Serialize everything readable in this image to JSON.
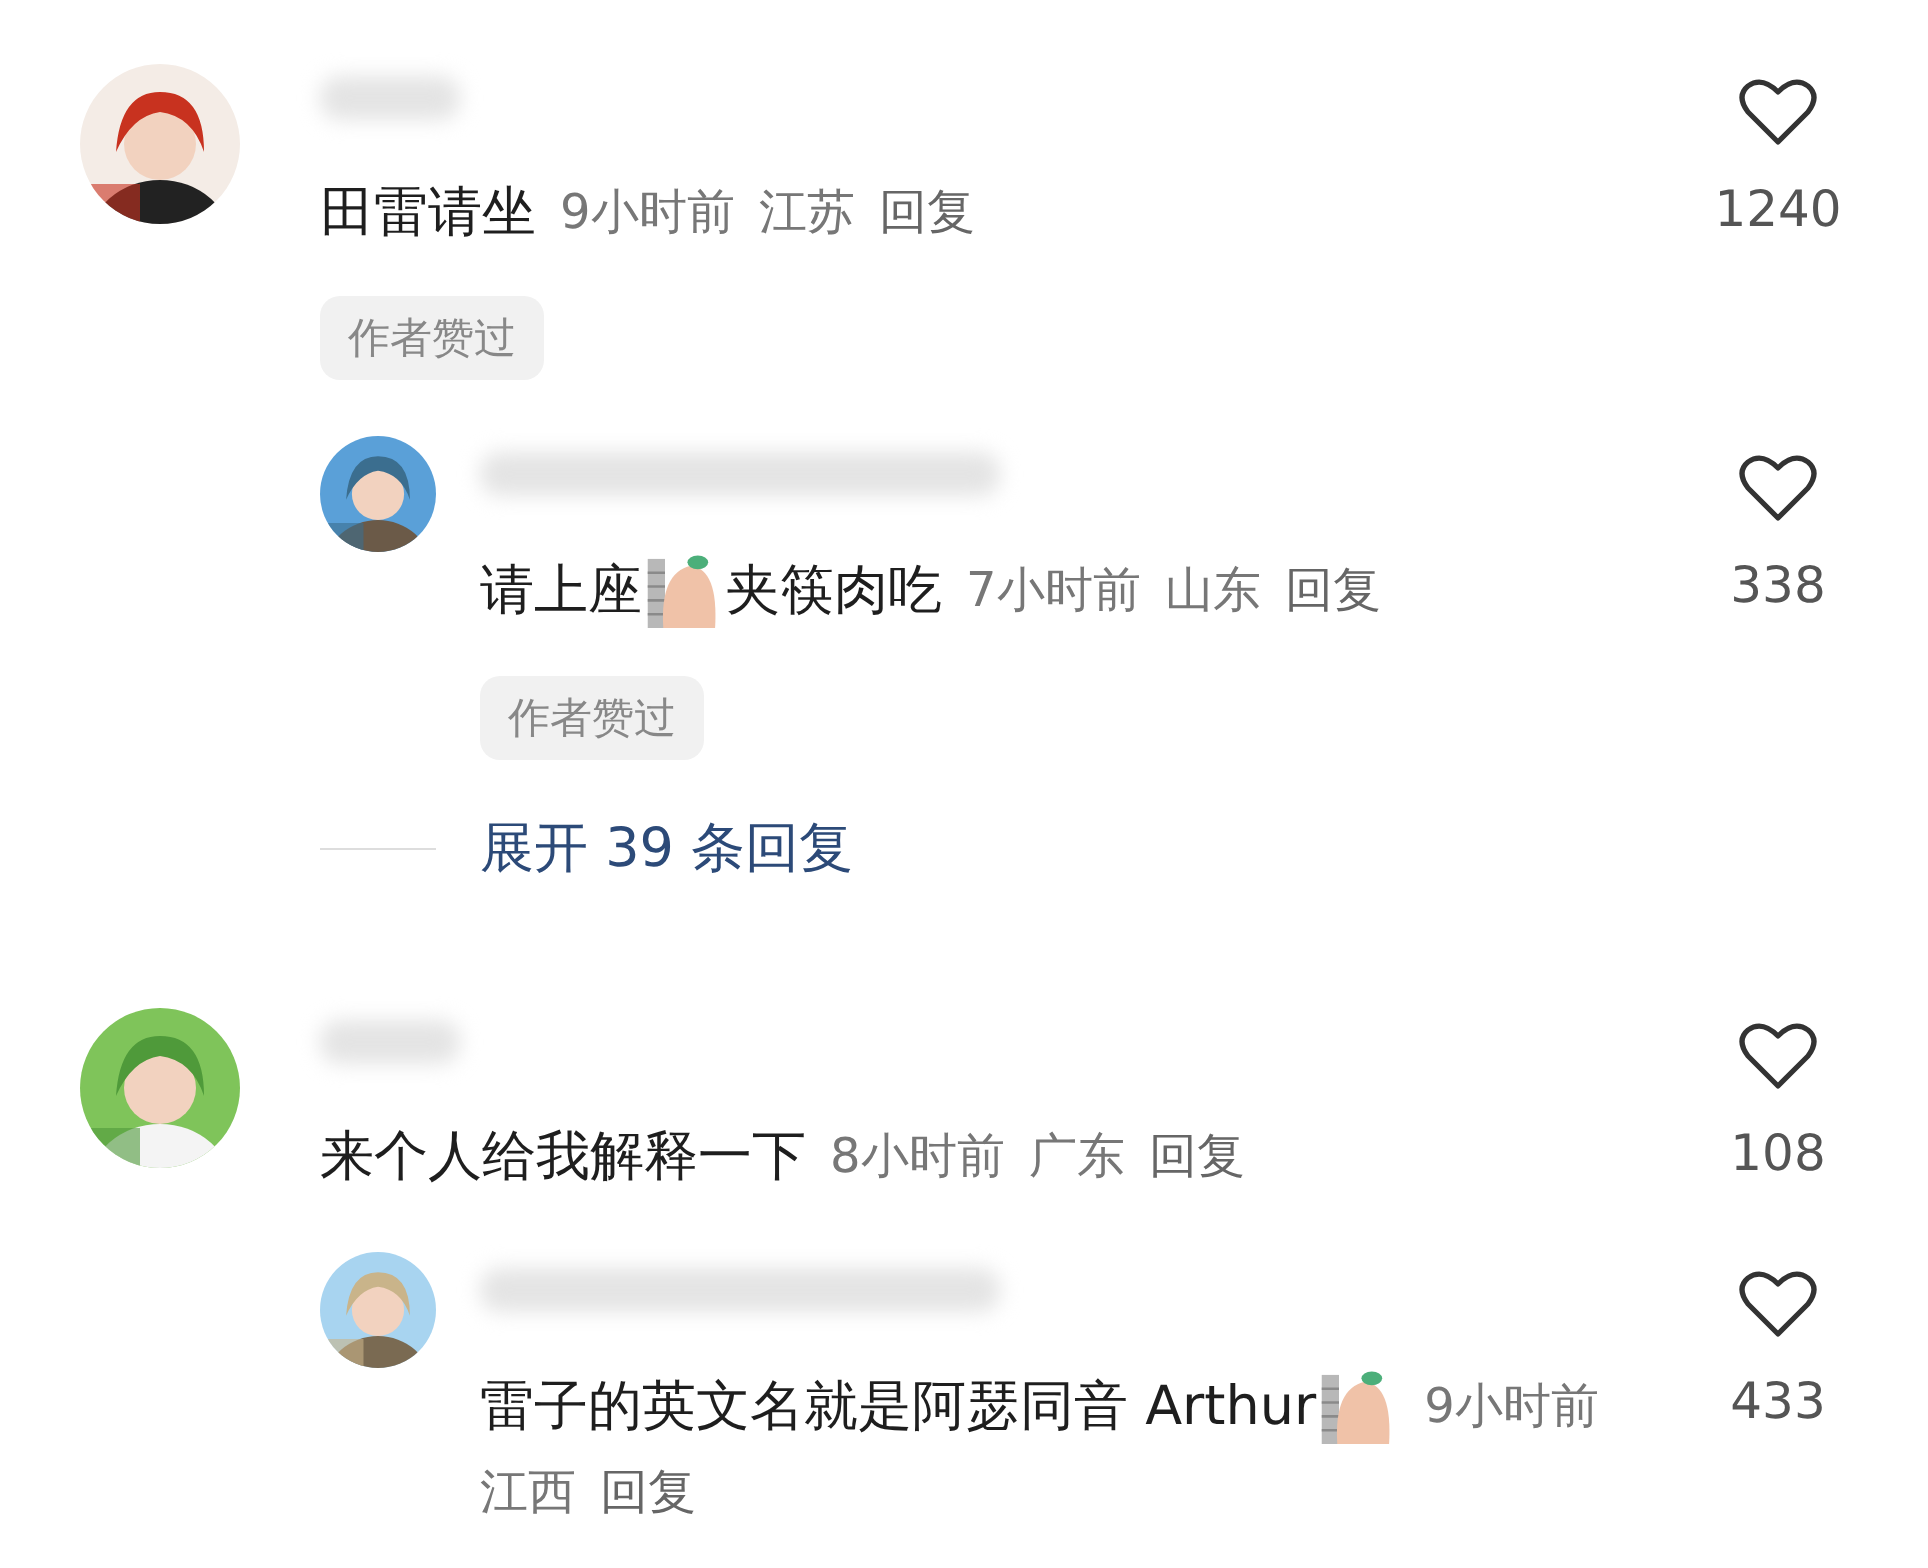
{
  "comments": [
    {
      "content": [
        {
          "kind": "text",
          "text": "田雷请坐"
        }
      ],
      "time": "9小时前",
      "location": "江苏",
      "reply": "回复",
      "likes": "1240",
      "author_liked": true,
      "author_badge": "作者赞过",
      "replies": [
        {
          "content": [
            {
              "kind": "text",
              "text": "请上座"
            },
            {
              "kind": "sticker"
            },
            {
              "kind": "text",
              "text": "夹筷肉吃"
            }
          ],
          "time": "7小时前",
          "location": "山东",
          "reply": "回复",
          "likes": "338",
          "author_liked": true,
          "author_badge": "作者赞过"
        }
      ],
      "expand": "展开 39 条回复"
    },
    {
      "content": [
        {
          "kind": "text",
          "text": "来个人给我解释一下"
        }
      ],
      "time": "8小时前",
      "location": "广东",
      "reply": "回复",
      "likes": "108",
      "author_liked": false,
      "replies": [
        {
          "content": [
            {
              "kind": "text",
              "text": "雷子的英文名就是阿瑟同音 Arthur"
            },
            {
              "kind": "sticker"
            }
          ],
          "time": "9小时前",
          "location": "江西",
          "reply": "回复",
          "likes": "433",
          "author_liked": false
        }
      ]
    }
  ]
}
